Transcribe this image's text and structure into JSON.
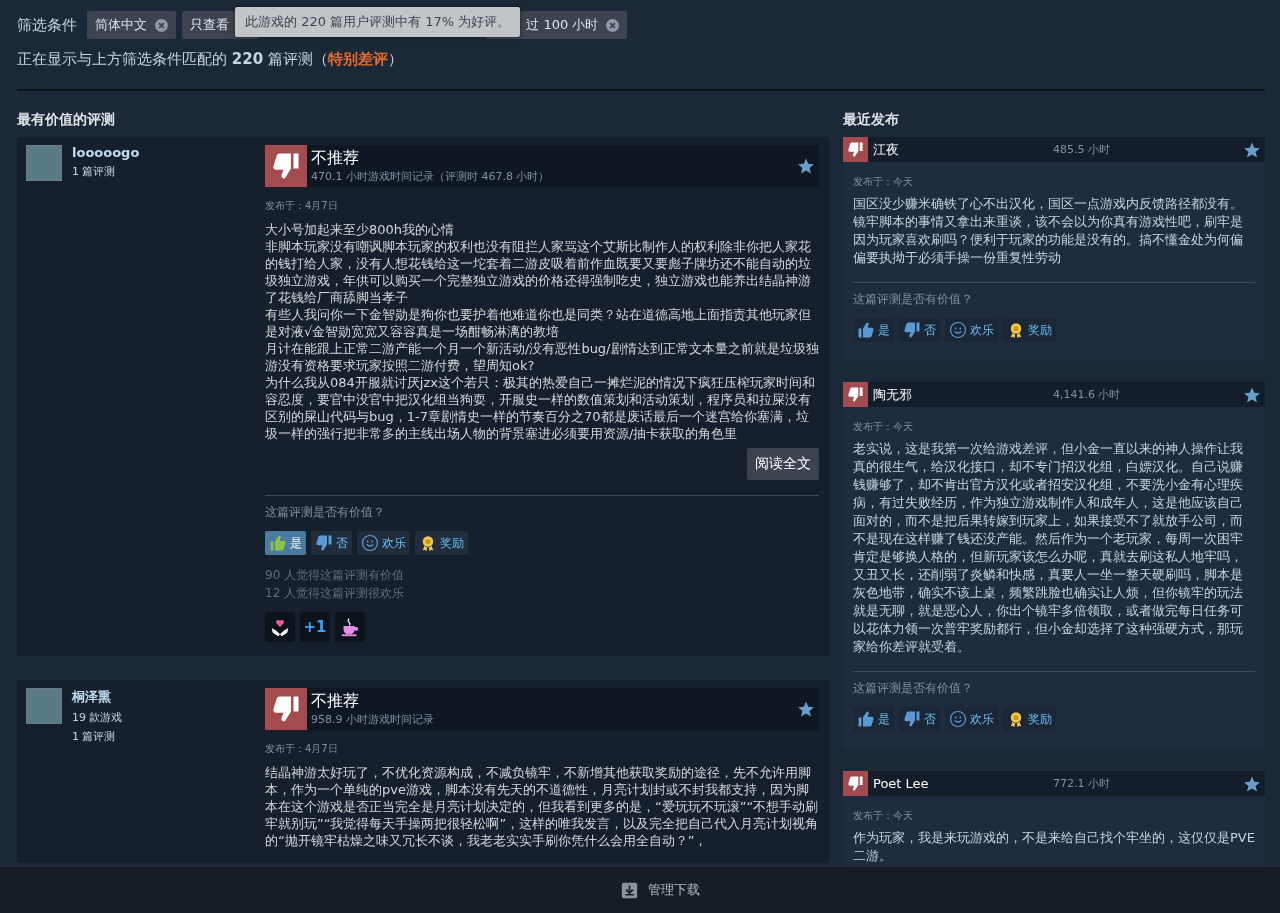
{
  "filters": {
    "label": "筛选条件",
    "tags": [
      {
        "label": "简体中文",
        "removable": true
      },
      {
        "label": "只查看"
      },
      {
        "label": "过 100 小时",
        "removable": true
      }
    ],
    "tooltip": "此游戏的 220 篇用户评测中有 17% 为好评。"
  },
  "summary": {
    "prefix": "正在显示与上方筛选条件匹配的 **220** 篇评测（",
    "rating": "特别差评",
    "suffix": "）"
  },
  "most_helpful": {
    "title": "最有价值的评测",
    "reviews": [
      {
        "author": "looooogo",
        "author_stats": [
          "1 篇评测"
        ],
        "recommended": false,
        "verdict": "不推荐",
        "hours": "470.1 小时游戏时间记录（评测时 467.8 小时）",
        "posted": "发布于：4月7日",
        "paragraphs": [
          "大小号加起来至少800h我的心情",
          "非脚本玩家没有嘲讽脚本玩家的权利也没有阻拦人家骂这个艾斯比制作人的权利除非你把人家花的钱打给人家，没有人想花钱给这一坨套着二游皮吸着前作血既要又要彪子牌坊还不能自动的垃圾独立游戏，年供可以购买一个完整独立游戏的价格还得强制吃史，独立游戏也能养出结晶神游了花钱给厂商舔脚当孝子",
          "有些人我问你一下金智勋是狗你也要护着他难道你也是同类？站在道德高地上面指责其他玩家但是对液√金智勋宽宽又容容真是一场酣畅淋漓的教培",
          "月计在能跟上正常二游产能一个月一个新活动/没有恶性bug/剧情达到正常文本量之前就是垃圾独游没有资格要求玩家按照二游付费，望周知ok?",
          "为什么我从084开服就讨厌jzx这个若只：极其的热爱自己一摊烂泥的情况下疯狂压榨玩家时间和容忍度，要官中没官中把汉化组当狗耍，开服史一样的数值策划和活动策划，程序员和拉屎没有区别的屎山代码与bug，1-7章剧情史一样的节奏百分之70都是废话最后一个迷宫给你塞满，垃圾一样的强行把非常多的主线出场人物的背景塞进必须要用资源/抽卡获取的角色里"
        ],
        "read_more": "阅读全文",
        "question": "这篇评测是否有价值？",
        "votes": [
          {
            "kind": "up",
            "label": "是",
            "selected": true
          },
          {
            "kind": "down",
            "label": "否",
            "selected": false
          },
          {
            "kind": "funny",
            "label": "欢乐",
            "selected": false
          },
          {
            "kind": "award",
            "label": "奖励",
            "selected": false
          }
        ],
        "counts": [
          "90 人觉得这篇评测有价值",
          "12 人觉得这篇评测很欢乐"
        ],
        "awards": [
          {
            "kind": "heart"
          },
          {
            "kind": "plus",
            "label": "+1"
          },
          {
            "kind": "cup"
          }
        ]
      },
      {
        "author": "桐泽熏",
        "author_stats": [
          "19 款游戏",
          "1 篇评测"
        ],
        "recommended": false,
        "verdict": "不推荐",
        "hours": "958.9 小时游戏时间记录",
        "posted": "发布于：4月7日",
        "paragraphs": [
          "结晶神游太好玩了，不优化资源构成，不减负镜牢，不新增其他获取奖励的途径，先不允许用脚本，作为一个单纯的pve游戏，脚本没有先天的不道德性，月亮计划封或不封我都支持，因为脚本在这个游戏是否正当完全是月亮计划决定的，但我看到更多的是，“爱玩玩不玩滚”“不想手动刷牢就别玩”“我觉得每天手操两把很轻松啊”，这样的唯我发言，以及完全把自己代入月亮计划视角的“抛开镜牢枯燥之味又冗长不谈，我老老实实手刷你凭什么会用全自动？”，"
        ]
      }
    ]
  },
  "recent": {
    "title": "最近发布",
    "reviews": [
      {
        "author": "江夜",
        "recommended": false,
        "hours": "485.5 小时",
        "posted": "发布于：今天",
        "body": "国区没少赚米确铁了心不出汉化，国区一点游戏内反馈路径都没有。镜牢脚本的事情又拿出来重谈，该不会以为你真有游戏性吧，刷牢是因为玩家喜欢刷吗？便利于玩家的功能是没有的。搞不懂金处为何偏偏要执拗于必须手操一份重复性劳动",
        "question": "这篇评测是否有价值？",
        "votes": [
          {
            "kind": "up",
            "label": "是",
            "selected": false
          },
          {
            "kind": "down",
            "label": "否",
            "selected": false
          },
          {
            "kind": "funny",
            "label": "欢乐",
            "selected": false
          },
          {
            "kind": "award",
            "label": "奖励",
            "selected": false
          }
        ]
      },
      {
        "author": "陶无邪",
        "recommended": false,
        "hours": "4,141.6 小时",
        "posted": "发布于：今天",
        "body": "老实说，这是我第一次给游戏差评，但小金一直以来的神人操作让我真的很生气，给汉化接口，却不专门招汉化组，白嫖汉化。自己说赚钱赚够了，却不肯出官方汉化或者招安汉化组，不要洗小金有心理疾病，有过失败经历，作为独立游戏制作人和成年人，这是他应该自己面对的，而不是把后果转嫁到玩家上，如果接受不了就放手公司，而不是现在这样赚了钱还没产能。然后作为一个老玩家，每周一次困牢肯定是够换人格的，但新玩家该怎么办呢，真就去刷这私人地牢吗，又丑又长，还削弱了炎鳞和快感，真要人一坐一整天硬刷吗，脚本是灰色地带，确实不该上桌，频繁跳脸也确实让人烦，但你镜牢的玩法就是无聊，就是恶心人，你出个镜牢多倍领取，或者做完每日任务可以花体力领一次普牢奖励都行，但小金却选择了这种强硬方式，那玩家给你差评就受着。",
        "question": "这篇评测是否有价值？",
        "votes": [
          {
            "kind": "up",
            "label": "是",
            "selected": false
          },
          {
            "kind": "down",
            "label": "否",
            "selected": false
          },
          {
            "kind": "funny",
            "label": "欢乐",
            "selected": false
          },
          {
            "kind": "award",
            "label": "奖励",
            "selected": false
          }
        ]
      },
      {
        "author": "Poet Lee",
        "recommended": false,
        "hours": "772.1 小时",
        "posted": "发布于：今天",
        "body": "作为玩家，我是来玩游戏的，不是来给自己找个牢坐的，这仅仅是PVE二游。"
      }
    ]
  },
  "footer": {
    "label": "管理下载"
  }
}
